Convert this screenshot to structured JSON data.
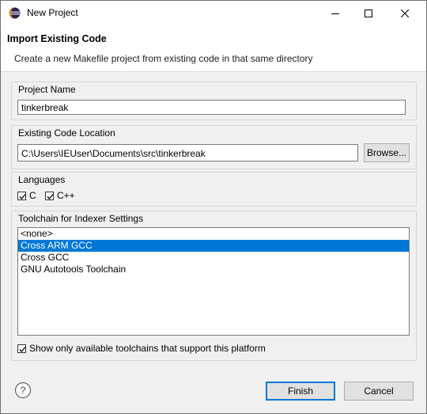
{
  "window": {
    "title": "New Project",
    "app_icon": "eclipse-icon"
  },
  "header": {
    "title": "Import Existing Code",
    "description": "Create a new Makefile project from existing code in that same directory"
  },
  "project_name": {
    "label": "Project Name",
    "value": "tinkerbreak"
  },
  "code_location": {
    "label": "Existing Code Location",
    "value": "C:\\Users\\IEUser\\Documents\\src\\tinkerbreak",
    "browse_label": "Browse..."
  },
  "languages": {
    "label": "Languages",
    "items": [
      {
        "label": "C",
        "checked": true
      },
      {
        "label": "C++",
        "checked": true
      }
    ]
  },
  "toolchain": {
    "label": "Toolchain for Indexer Settings",
    "items": [
      {
        "label": "<none>",
        "selected": false
      },
      {
        "label": "Cross ARM GCC",
        "selected": true
      },
      {
        "label": "Cross GCC",
        "selected": false
      },
      {
        "label": "GNU Autotools Toolchain",
        "selected": false
      }
    ],
    "filter_label": "Show only available toolchains that support this platform",
    "filter_checked": true
  },
  "footer": {
    "finish_label": "Finish",
    "cancel_label": "Cancel",
    "help_icon": "help-icon"
  },
  "colors": {
    "selection": "#0078d7",
    "dialog_bg": "#f0f0f0",
    "header_bg": "#ffffff"
  }
}
